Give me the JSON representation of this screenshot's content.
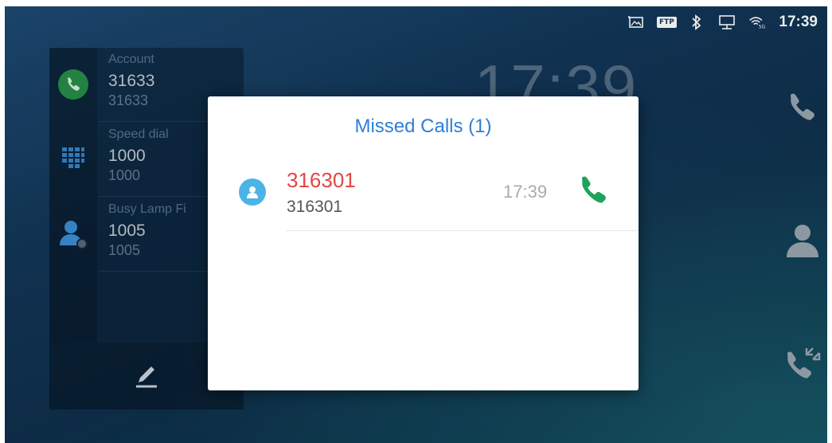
{
  "status_bar": {
    "icons": [
      "screenshot-icon",
      "ftp-icon",
      "bluetooth-icon",
      "network-icon",
      "wifi-5g-icon"
    ],
    "ftp_label": "FTP",
    "time": "17:39"
  },
  "background_clock": "17:39",
  "left_panel": {
    "items": [
      {
        "label": "Account",
        "primary": "31633",
        "secondary": "31633",
        "icon": "phone-icon"
      },
      {
        "label": "Speed dial",
        "primary": "1000",
        "secondary": "1000",
        "icon": "dialpad-icon"
      },
      {
        "label": "Busy Lamp Fi",
        "primary": "1005",
        "secondary": "1005",
        "icon": "contact-status-icon"
      }
    ],
    "edit_icon": "pencil-icon"
  },
  "right_panel": {
    "icons": [
      "phone-icon",
      "contacts-icon",
      "call-history-icon"
    ]
  },
  "dialog": {
    "title": "Missed Calls (1)",
    "calls": [
      {
        "name": "316301",
        "number": "316301",
        "time": "17:39",
        "action_icon": "phone-callback-icon"
      }
    ]
  },
  "colors": {
    "accent_blue": "#2e7fd6",
    "missed_red": "#e54545",
    "call_green": "#1fa35a",
    "avatar_blue": "#4cb3e6"
  }
}
